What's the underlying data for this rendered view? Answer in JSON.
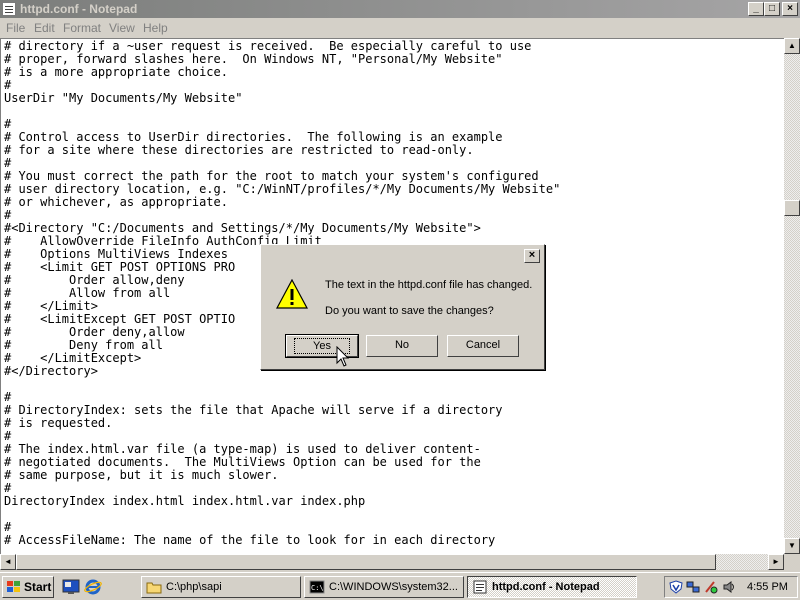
{
  "window": {
    "title": "httpd.conf - Notepad"
  },
  "menu": {
    "file": "File",
    "edit": "Edit",
    "format": "Format",
    "view": "View",
    "help": "Help"
  },
  "editor": {
    "text": "# directory if a ~user request is received.  Be especially careful to use\n# proper, forward slashes here.  On Windows NT, \"Personal/My Website\"\n# is a more appropriate choice.\n#\nUserDir \"My Documents/My Website\"\n\n#\n# Control access to UserDir directories.  The following is an example\n# for a site where these directories are restricted to read-only.\n#\n# You must correct the path for the root to match your system's configured\n# user directory location, e.g. \"C:/WinNT/profiles/*/My Documents/My Website\"\n# or whichever, as appropriate.\n#\n#<Directory \"C:/Documents and Settings/*/My Documents/My Website\">\n#    AllowOverride FileInfo AuthConfig Limit\n#    Options MultiViews Indexes\n#    <Limit GET POST OPTIONS PRO\n#        Order allow,deny\n#        Allow from all\n#    </Limit>\n#    <LimitExcept GET POST OPTIO\n#        Order deny,allow\n#        Deny from all\n#    </LimitExcept>\n#</Directory>\n\n#\n# DirectoryIndex: sets the file that Apache will serve if a directory\n# is requested.\n#\n# The index.html.var file (a type-map) is used to deliver content-\n# negotiated documents.  The MultiViews Option can be used for the\n# same purpose, but it is much slower.\n#\nDirectoryIndex index.html index.html.var index.php\n\n#\n# AccessFileName: The name of the file to look for in each directory"
  },
  "dialog": {
    "message": "The text in the httpd.conf file has changed.",
    "question": "Do you want to save the changes?",
    "yes": "Yes",
    "no": "No",
    "cancel": "Cancel",
    "close_glyph": "×"
  },
  "taskbar": {
    "start": "Start",
    "tasks": [
      {
        "label": "C:\\php\\sapi"
      },
      {
        "label": "C:\\WINDOWS\\system32..."
      },
      {
        "label": "httpd.conf - Notepad"
      }
    ],
    "clock": "4:55 PM"
  }
}
